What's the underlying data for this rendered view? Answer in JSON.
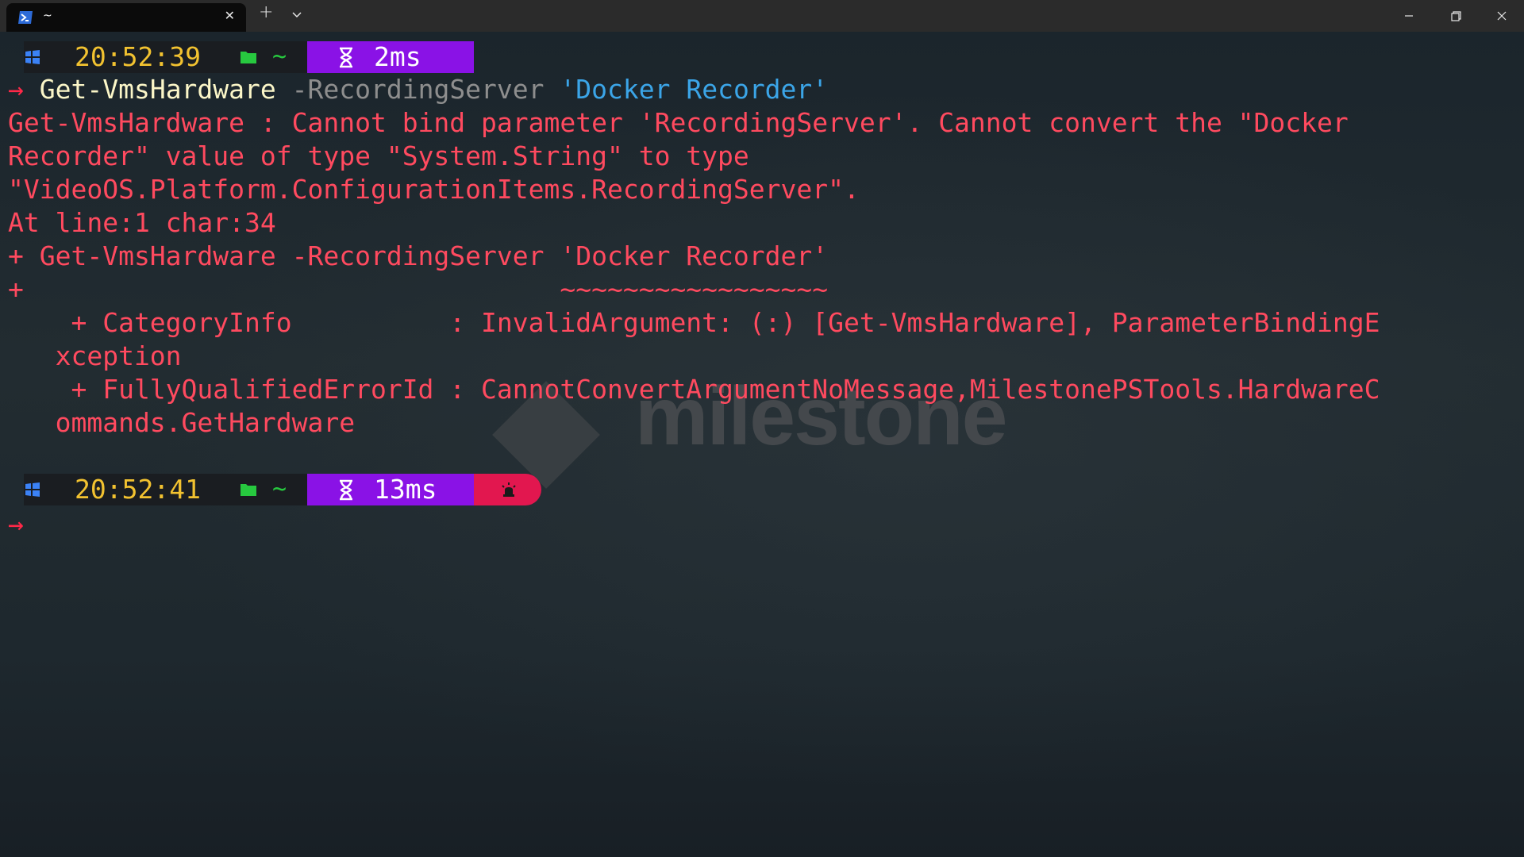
{
  "tab": {
    "title": "~",
    "close_label": "✕"
  },
  "titlebar": {
    "new_tab_label": "+"
  },
  "prompts": [
    {
      "time": "20:52:39",
      "path": "~",
      "duration": "2ms"
    },
    {
      "time": "20:52:41",
      "path": "~",
      "duration": "13ms"
    }
  ],
  "prompt_symbol": "→",
  "command": {
    "name": "Get-VmsHardware",
    "param": "-RecordingServer",
    "value": "'Docker Recorder'"
  },
  "error_lines": [
    "Get-VmsHardware : Cannot bind parameter 'RecordingServer'. Cannot convert the \"Docker",
    "Recorder\" value of type \"System.String\" to type",
    "\"VideoOS.Platform.ConfigurationItems.RecordingServer\".",
    "At line:1 char:34",
    "+ Get-VmsHardware -RecordingServer 'Docker Recorder'",
    "+                                  ~~~~~~~~~~~~~~~~~",
    "    + CategoryInfo          : InvalidArgument: (:) [Get-VmsHardware], ParameterBindingE",
    "   xception",
    "    + FullyQualifiedErrorId : CannotConvertArgumentNoMessage,MilestonePSTools.HardwareC",
    "   ommands.GetHardware"
  ],
  "watermark": {
    "text": "milestone"
  },
  "icons": {
    "tab": "powershell-icon",
    "os": "windows-icon",
    "folder": "folder-icon",
    "duration": "hourglass-icon",
    "error": "siren-icon"
  },
  "colors": {
    "error": "#ff4a5f",
    "time": "#f2c230",
    "duration_segment": "#8a12e6",
    "error_segment": "#e2174f",
    "string": "#3ba5e8",
    "folder": "#27c93f"
  }
}
